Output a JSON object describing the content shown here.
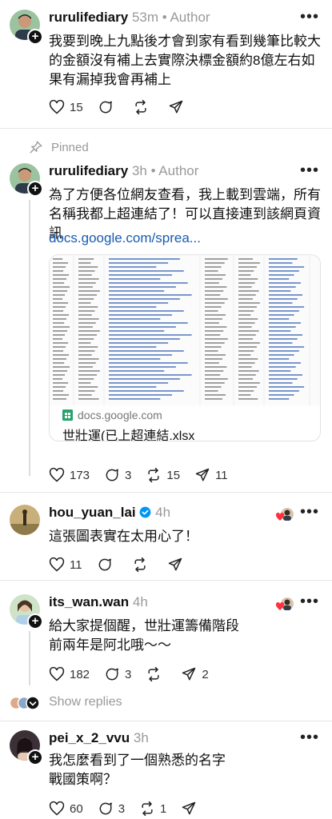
{
  "colors": {
    "text": "#101010",
    "muted": "#999999",
    "link": "#1a5bb0",
    "verified": "#0095f6",
    "like_red": "#ff3040",
    "divider": "#e6e6e6"
  },
  "post1": {
    "username": "rurulifediary",
    "meta": "53m • Author",
    "text": "我要到晚上九點後才會到家有看到幾筆比較大的金額沒有補上去實際決標金額約8億左右如果有漏掉我會再補上",
    "likes": "15"
  },
  "pinned_label": "Pinned",
  "post2": {
    "username": "rurulifediary",
    "meta": "3h • Author",
    "text": "為了方便各位網友查看，我上載到雲端，所有名稱我都上超連結了！可以直接連到該網頁資訊",
    "link": "docs.google.com/sprea...",
    "preview_domain": "docs.google.com",
    "preview_title": "世壯運(已上超連結.xlsx",
    "likes": "173",
    "replies": "3",
    "reposts": "15",
    "shares": "11"
  },
  "post3": {
    "username": "hou_yuan_lai",
    "meta": "4h",
    "text": "這張圖表實在太用心了！",
    "likes": "11"
  },
  "post4": {
    "username": "its_wan.wan",
    "meta": "4h",
    "text_line1": "給大家提個醒，世壯運籌備階段",
    "text_line2": "前兩年是阿北哦～～",
    "likes": "182",
    "replies": "3",
    "shares": "2"
  },
  "show_replies": "Show replies",
  "post5": {
    "username": "pei_x_2_vvu",
    "meta": "3h",
    "text_line1": "我怎麼看到了一個熟悉的名字",
    "text_line2": "戰國策啊？",
    "likes": "60",
    "replies": "3",
    "reposts": "1"
  }
}
